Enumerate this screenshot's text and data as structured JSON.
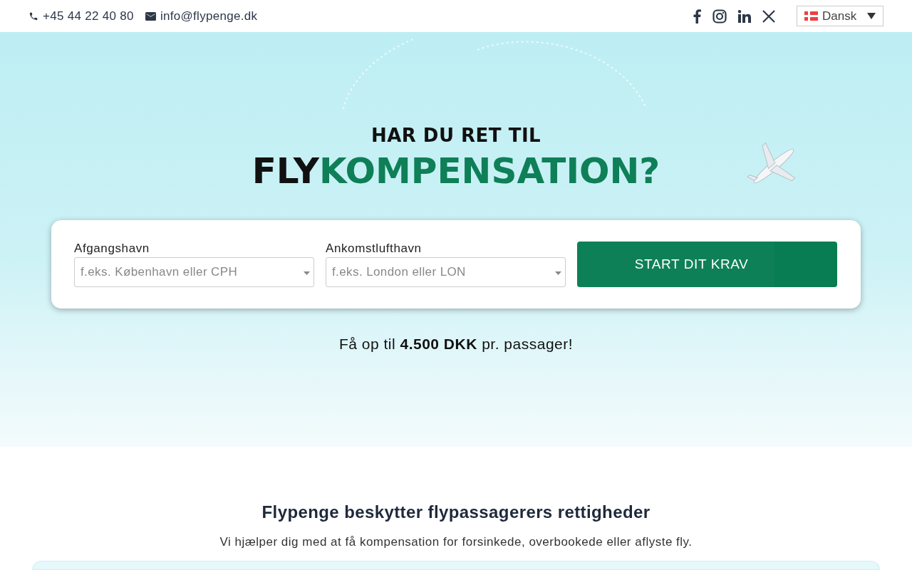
{
  "topbar": {
    "phone": "+45 44 22 40 80",
    "email": "info@flypenge.dk",
    "language": "Dansk"
  },
  "hero": {
    "kicker": "HAR DU RET TIL",
    "title_dark": "FLY",
    "title_green": "KOMPENSATION?",
    "fields": [
      {
        "label": "Afgangshavn",
        "placeholder": "f.eks. København eller CPH"
      },
      {
        "label": "Ankomstlufthavn",
        "placeholder": "f.eks. London eller LON"
      }
    ],
    "submit": "START DIT KRAV",
    "offer": "Få op til **4.500 DKK** pr. passager!"
  },
  "section": {
    "title": "Flypenge beskytter flypassagerers rettigheder",
    "subtitle": "Vi hjælper dig med at få kompensation for forsinkede, overbookede eller aflyste fly."
  }
}
